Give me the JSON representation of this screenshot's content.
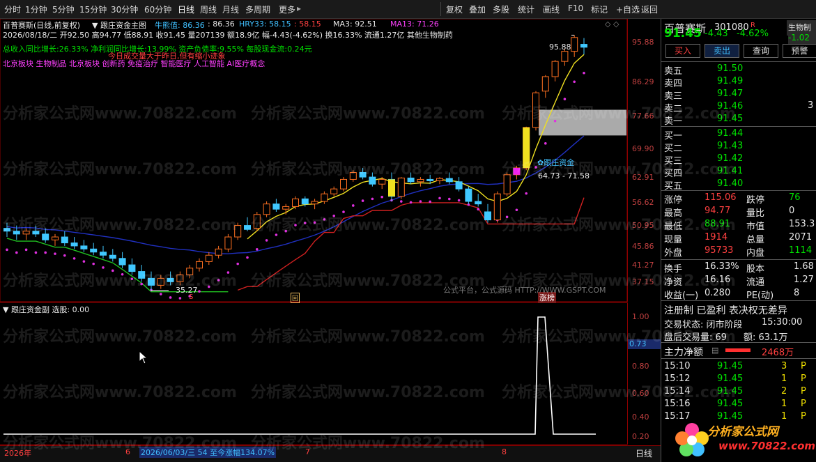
{
  "toolbar": {
    "items": [
      "分时",
      "1分钟",
      "5分钟",
      "15分钟",
      "30分钟",
      "60分钟",
      "日线",
      "周线",
      "月线",
      "多周期",
      "更多"
    ],
    "right_items": [
      "复权",
      "叠加",
      "多股",
      "统计",
      "画线",
      "F10",
      "标记",
      "+自选",
      "返回"
    ]
  },
  "chart": {
    "title": "百普赛斯(日线,前复权)",
    "main_indicator": "跟庄资金主图",
    "cow_label": "牛熊值: 86.36",
    "cow_value": ": 86.36",
    "hry_label": "HRY33: 58.15",
    "hry_value": ": 58.15",
    "ma3_label": "MA3: 92.51",
    "ma13_label": "MA13: 71.26",
    "info_line": "2026/08/18/二 开92.50 高94.77 低88.91 收91.45 量207139 额18.9亿 幅-4.43(-4.62%) 换16.33% 流通1.27亿 其他生物制药",
    "fin_line": "总收入同比增长:26.33% 净利润同比增长:13.99% 资产负债率:9.55% 每股现金流:0.24元",
    "warn_line": "今日成交量大于昨日,但有缩小迹象",
    "concept_line": "北京板块 生物制品 北京板块 创新药 免疫治疗 智能医疗 人工智能 AI医疗概念",
    "price_axis": [
      "95.88",
      "86.29",
      "77.66",
      "69.90",
      "62.91",
      "56.62",
      "50.95",
      "45.86",
      "41.27",
      "37.15"
    ],
    "high_label": "95.88",
    "low_label": "35.27",
    "zone_label": "跟庄资金",
    "zone_range": "64.73 - 71.58",
    "marker_s": "S",
    "marker_hui": "回",
    "marker_zt": "涨榜",
    "gspt": "公式平台，公式源码 HTTP://WWW.GSPT.COM",
    "sub_title": "跟庄资金副",
    "sub_value": "选股: 0.00",
    "sub_axis": [
      "1.00",
      "0.80",
      "0.60",
      "0.40",
      "0.20"
    ],
    "sub_current": "0.73",
    "status_items": [
      "2026年",
      "6",
      "2026/06/03/三 54 至今涨幅134.07%",
      "7",
      "8"
    ],
    "status_right": "日线",
    "candles": [
      [
        45,
        46,
        43.5,
        44.5
      ],
      [
        44.5,
        45.5,
        43,
        44
      ],
      [
        44,
        45,
        43,
        44.5
      ],
      [
        44.5,
        45.5,
        43.5,
        44
      ],
      [
        44,
        45,
        42.5,
        43
      ],
      [
        43,
        44,
        42,
        43.5
      ],
      [
        43.5,
        44.5,
        42,
        42.5
      ],
      [
        42.5,
        43.5,
        41.5,
        42
      ],
      [
        42,
        43,
        41,
        41.5
      ],
      [
        41.5,
        42.5,
        40.5,
        41
      ],
      [
        41,
        42,
        40,
        40.5
      ],
      [
        40.5,
        41.5,
        39.5,
        40
      ],
      [
        40,
        41,
        38.5,
        39
      ],
      [
        39,
        40,
        37.5,
        38
      ],
      [
        38,
        39,
        36.5,
        37
      ],
      [
        37,
        38,
        35.27,
        36
      ],
      [
        36,
        37.5,
        35.5,
        37
      ],
      [
        37,
        38,
        36,
        36.5
      ],
      [
        36.5,
        38,
        36,
        37.5
      ],
      [
        37.5,
        39,
        37,
        38.5
      ],
      [
        38.5,
        40,
        38,
        39.5
      ],
      [
        39.5,
        41,
        39,
        40.5
      ],
      [
        40.5,
        42,
        40,
        41.5
      ],
      [
        41.5,
        44,
        41,
        43.5
      ],
      [
        43.5,
        46,
        43,
        45.5
      ],
      [
        45.5,
        47,
        44.5,
        44.8
      ],
      [
        45,
        48,
        44.5,
        47.5
      ],
      [
        47.5,
        50,
        47,
        49.5
      ],
      [
        49.5,
        50.5,
        48,
        48.5
      ],
      [
        48.5,
        49.5,
        47.5,
        49
      ],
      [
        49,
        51,
        48.5,
        50.5
      ],
      [
        50.5,
        51,
        49,
        49.5
      ],
      [
        49.5,
        50.5,
        48.5,
        50
      ],
      [
        50,
        52,
        49.5,
        51.5
      ],
      [
        51.5,
        53,
        51,
        52.5
      ],
      [
        52.5,
        55,
        52,
        54.5
      ],
      [
        54.5,
        56.5,
        54,
        56
      ],
      [
        56,
        57,
        54.5,
        55
      ],
      [
        55,
        56,
        53,
        53.5
      ],
      [
        53.5,
        55,
        52.5,
        54.5
      ],
      [
        54.5,
        56,
        50,
        51
      ],
      [
        51,
        55,
        50.5,
        54.8
      ],
      [
        54.8,
        56,
        53.5,
        54
      ],
      [
        54,
        55,
        53,
        54.5
      ],
      [
        54.5,
        55.5,
        53.5,
        54.2
      ],
      [
        54.2,
        55,
        53.5,
        54.7
      ],
      [
        54.7,
        56,
        53.5,
        54
      ],
      [
        54,
        55,
        52,
        52.5
      ],
      [
        52.5,
        53,
        49.5,
        50
      ],
      [
        50,
        51.5,
        49,
        49.5
      ],
      [
        48,
        49.5,
        46,
        46.5
      ],
      [
        46.5,
        52,
        46,
        51.5
      ],
      [
        51.5,
        56,
        51,
        55.5
      ],
      [
        55.5,
        57.5,
        54.5,
        57
      ],
      [
        57,
        67,
        56.5,
        66.8
      ],
      [
        66.8,
        77,
        66,
        76.5
      ],
      [
        77,
        82,
        75,
        81.5
      ],
      [
        81.5,
        87,
        80,
        86.5
      ],
      [
        86.5,
        91,
        85,
        90
      ],
      [
        90,
        95.88,
        88,
        95
      ],
      [
        92.5,
        94.77,
        88.91,
        91.45
      ]
    ],
    "envelope": [
      [
        46,
        8
      ],
      [
        46,
        16
      ],
      [
        46,
        22
      ],
      [
        46,
        30
      ],
      [
        47,
        38
      ],
      [
        48,
        46
      ],
      [
        49,
        52
      ],
      [
        50,
        55
      ]
    ]
  },
  "right_panel": {
    "stock_name": "百普赛斯",
    "stock_code": "301080",
    "r_mark": "R",
    "side_label": "生物制",
    "price": "91.45",
    "change": "-4.43",
    "pct": "-4.62%",
    "side_change": "-1.02",
    "buttons": [
      "买入",
      "卖出",
      "查询",
      "预警"
    ],
    "asks": [
      [
        "卖五",
        "91.50"
      ],
      [
        "卖四",
        "91.49"
      ],
      [
        "卖三",
        "91.47"
      ],
      [
        "卖二",
        "91.46"
      ],
      [
        "卖一",
        "91.45"
      ]
    ],
    "ask_side": "3",
    "bids": [
      [
        "买一",
        "91.44"
      ],
      [
        "买二",
        "91.43"
      ],
      [
        "买三",
        "91.42"
      ],
      [
        "买四",
        "91.41"
      ],
      [
        "买五",
        "91.40"
      ]
    ],
    "stats": [
      [
        "涨停",
        "115.06",
        "跌停",
        "76"
      ],
      [
        "最高",
        "94.77",
        "量比",
        "0"
      ],
      [
        "最低",
        "88.91",
        "市值",
        "153.3"
      ],
      [
        "现量",
        "1914",
        "总量",
        "2071"
      ],
      [
        "外盘",
        "95733",
        "内盘",
        "1114"
      ]
    ],
    "stats2": [
      [
        "换手",
        "16.33%",
        "股本",
        "1.68"
      ],
      [
        "净资",
        "16.16",
        "流通",
        "1.27"
      ],
      [
        "收益(一)",
        "0.280",
        "PE(动)",
        "8"
      ]
    ],
    "reg_line": "注册制 已盈利 表决权无差异",
    "trade_state": "交易状态: 闭市阶段",
    "trade_time": "15:30:00",
    "after_vol": "盘后交易量: 69",
    "after_amt": "额: 63.1万",
    "net_label": "主力净额",
    "net_value": "2468万",
    "ticks": [
      [
        "15:10",
        "91.45",
        "3",
        "P"
      ],
      [
        "15:12",
        "91.45",
        "1",
        "P"
      ],
      [
        "15:14",
        "91.45",
        "2",
        "P"
      ],
      [
        "15:16",
        "91.45",
        "1",
        "P"
      ],
      [
        "15:17",
        "91.45",
        "1",
        "P"
      ]
    ],
    "logo_text": "分析家公式网",
    "logo_url": "www.70822.com"
  },
  "watermark": "分析家公式网www.70822.com"
}
